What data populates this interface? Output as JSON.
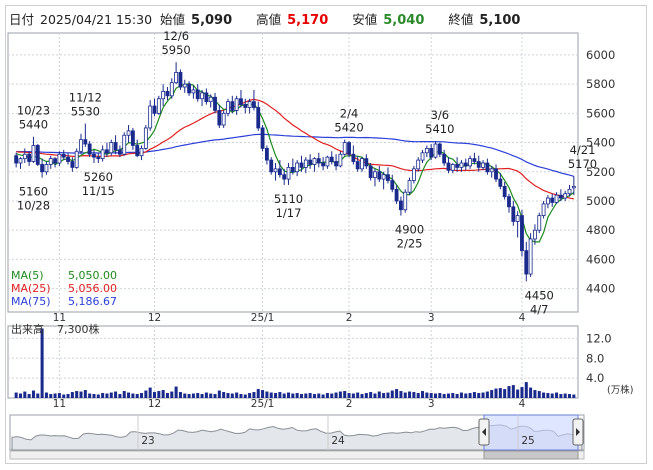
{
  "header": {
    "date_label": "日付",
    "date_value": "2025/04/21 15:30",
    "open_label": "始値",
    "open_value": "5,090",
    "high_label": "高値",
    "high_value": "5,170",
    "low_label": "安値",
    "low_value": "5,040",
    "close_label": "終値",
    "close_value": "5,100"
  },
  "colors": {
    "up_candle": "#ffffff",
    "down_candle": "#1a2a8c",
    "ma5": "#1f8a1f",
    "ma25": "#e02020",
    "ma75": "#2a3fd8",
    "volume": "#1a2a8c",
    "grid": "#cfd4dc"
  },
  "legend": {
    "ma5_label": "MA(5)",
    "ma5_value": "5,050.00",
    "ma25_label": "MA(25)",
    "ma25_value": "5,056.00",
    "ma75_label": "MA(75)",
    "ma75_value": "5,186.67"
  },
  "volume_panel": {
    "title": "出来高",
    "value": "7,300株",
    "unit": "(万株)",
    "ticks": [
      "12.0",
      "8.0",
      "4.0"
    ]
  },
  "navigator": {
    "labels": [
      "23",
      "24",
      "25"
    ]
  },
  "chart_data": {
    "type": "candlestick",
    "ylim": [
      4240,
      6150
    ],
    "yticks": [
      4400,
      4600,
      4800,
      5000,
      5200,
      5400,
      5600,
      5800,
      6000
    ],
    "xticks": [
      {
        "index": 10,
        "label": "11"
      },
      {
        "index": 32,
        "label": "12"
      },
      {
        "index": 57,
        "label": "25/1"
      },
      {
        "index": 77,
        "label": "2"
      },
      {
        "index": 96,
        "label": "3"
      },
      {
        "index": 117,
        "label": "4"
      }
    ],
    "annotations": [
      {
        "index": 4,
        "value": 5440,
        "text": [
          "10/23",
          "5440"
        ],
        "pos": "above"
      },
      {
        "index": 4,
        "value": 5160,
        "text": [
          "5160",
          "10/28"
        ],
        "pos": "below"
      },
      {
        "index": 16,
        "value": 5530,
        "text": [
          "11/12",
          "5530"
        ],
        "pos": "above"
      },
      {
        "index": 19,
        "value": 5260,
        "text": [
          "5260",
          "11/15"
        ],
        "pos": "below"
      },
      {
        "index": 37,
        "value": 5950,
        "text": [
          "12/6",
          "5950"
        ],
        "pos": "above"
      },
      {
        "index": 63,
        "value": 5110,
        "text": [
          "5110",
          "1/17"
        ],
        "pos": "below"
      },
      {
        "index": 77,
        "value": 5420,
        "text": [
          "2/4",
          "5420"
        ],
        "pos": "above"
      },
      {
        "index": 91,
        "value": 4900,
        "text": [
          "4900",
          "2/25"
        ],
        "pos": "below"
      },
      {
        "index": 98,
        "value": 5410,
        "text": [
          "3/6",
          "5410"
        ],
        "pos": "above"
      },
      {
        "index": 121,
        "value": 4450,
        "text": [
          "4450",
          "4/7"
        ],
        "pos": "below"
      },
      {
        "index": 131,
        "value": 5170,
        "text": [
          "4/21",
          "5170"
        ],
        "pos": "above"
      }
    ],
    "ohlc": [
      [
        5310,
        5330,
        5230,
        5260
      ],
      [
        5260,
        5300,
        5220,
        5290
      ],
      [
        5290,
        5360,
        5260,
        5320
      ],
      [
        5320,
        5340,
        5240,
        5270
      ],
      [
        5270,
        5440,
        5260,
        5380
      ],
      [
        5380,
        5390,
        5240,
        5250
      ],
      [
        5250,
        5290,
        5160,
        5200
      ],
      [
        5200,
        5270,
        5180,
        5250
      ],
      [
        5250,
        5310,
        5220,
        5290
      ],
      [
        5290,
        5300,
        5230,
        5260
      ],
      [
        5260,
        5340,
        5240,
        5320
      ],
      [
        5320,
        5350,
        5280,
        5300
      ],
      [
        5300,
        5330,
        5250,
        5270
      ],
      [
        5270,
        5300,
        5200,
        5230
      ],
      [
        5230,
        5360,
        5220,
        5340
      ],
      [
        5340,
        5460,
        5320,
        5420
      ],
      [
        5420,
        5530,
        5370,
        5390
      ],
      [
        5390,
        5410,
        5300,
        5320
      ],
      [
        5320,
        5350,
        5260,
        5300
      ],
      [
        5300,
        5330,
        5260,
        5290
      ],
      [
        5290,
        5380,
        5270,
        5350
      ],
      [
        5350,
        5400,
        5300,
        5330
      ],
      [
        5330,
        5420,
        5310,
        5400
      ],
      [
        5400,
        5450,
        5320,
        5350
      ],
      [
        5350,
        5380,
        5300,
        5320
      ],
      [
        5320,
        5470,
        5310,
        5450
      ],
      [
        5450,
        5520,
        5400,
        5480
      ],
      [
        5480,
        5500,
        5350,
        5380
      ],
      [
        5380,
        5420,
        5300,
        5310
      ],
      [
        5310,
        5380,
        5280,
        5360
      ],
      [
        5360,
        5520,
        5350,
        5500
      ],
      [
        5500,
        5690,
        5480,
        5650
      ],
      [
        5650,
        5700,
        5580,
        5600
      ],
      [
        5600,
        5720,
        5590,
        5700
      ],
      [
        5700,
        5800,
        5650,
        5750
      ],
      [
        5750,
        5780,
        5690,
        5720
      ],
      [
        5720,
        5840,
        5700,
        5810
      ],
      [
        5810,
        5950,
        5800,
        5880
      ],
      [
        5880,
        5900,
        5760,
        5780
      ],
      [
        5780,
        5830,
        5740,
        5800
      ],
      [
        5800,
        5820,
        5720,
        5740
      ],
      [
        5740,
        5790,
        5700,
        5760
      ],
      [
        5760,
        5800,
        5680,
        5700
      ],
      [
        5700,
        5760,
        5650,
        5740
      ],
      [
        5740,
        5770,
        5660,
        5680
      ],
      [
        5680,
        5730,
        5640,
        5710
      ],
      [
        5710,
        5740,
        5600,
        5620
      ],
      [
        5620,
        5660,
        5500,
        5520
      ],
      [
        5520,
        5620,
        5500,
        5600
      ],
      [
        5600,
        5700,
        5580,
        5680
      ],
      [
        5680,
        5720,
        5600,
        5620
      ],
      [
        5620,
        5720,
        5590,
        5700
      ],
      [
        5700,
        5760,
        5640,
        5660
      ],
      [
        5660,
        5700,
        5600,
        5640
      ],
      [
        5640,
        5700,
        5600,
        5680
      ],
      [
        5680,
        5760,
        5620,
        5640
      ],
      [
        5640,
        5680,
        5480,
        5500
      ],
      [
        5500,
        5520,
        5340,
        5360
      ],
      [
        5360,
        5380,
        5250,
        5280
      ],
      [
        5280,
        5300,
        5180,
        5200
      ],
      [
        5200,
        5260,
        5140,
        5220
      ],
      [
        5220,
        5280,
        5160,
        5180
      ],
      [
        5180,
        5220,
        5110,
        5150
      ],
      [
        5150,
        5260,
        5110,
        5230
      ],
      [
        5230,
        5290,
        5180,
        5200
      ],
      [
        5200,
        5280,
        5170,
        5260
      ],
      [
        5260,
        5310,
        5200,
        5230
      ],
      [
        5230,
        5300,
        5190,
        5280
      ],
      [
        5280,
        5320,
        5220,
        5250
      ],
      [
        5250,
        5300,
        5200,
        5290
      ],
      [
        5290,
        5330,
        5230,
        5260
      ],
      [
        5260,
        5300,
        5210,
        5240
      ],
      [
        5240,
        5310,
        5220,
        5300
      ],
      [
        5300,
        5340,
        5250,
        5270
      ],
      [
        5270,
        5320,
        5210,
        5240
      ],
      [
        5240,
        5340,
        5230,
        5320
      ],
      [
        5320,
        5420,
        5310,
        5400
      ],
      [
        5400,
        5410,
        5300,
        5320
      ],
      [
        5320,
        5380,
        5250,
        5270
      ],
      [
        5270,
        5310,
        5200,
        5220
      ],
      [
        5220,
        5300,
        5200,
        5290
      ],
      [
        5290,
        5320,
        5220,
        5240
      ],
      [
        5240,
        5260,
        5140,
        5160
      ],
      [
        5160,
        5220,
        5100,
        5200
      ],
      [
        5200,
        5240,
        5130,
        5150
      ],
      [
        5150,
        5200,
        5080,
        5180
      ],
      [
        5180,
        5230,
        5120,
        5140
      ],
      [
        5140,
        5180,
        5060,
        5080
      ],
      [
        5080,
        5110,
        4980,
        5000
      ],
      [
        5000,
        5030,
        4900,
        4940
      ],
      [
        4940,
        5080,
        4920,
        5060
      ],
      [
        5060,
        5160,
        5040,
        5140
      ],
      [
        5140,
        5240,
        5120,
        5220
      ],
      [
        5220,
        5300,
        5200,
        5280
      ],
      [
        5280,
        5350,
        5260,
        5330
      ],
      [
        5330,
        5380,
        5300,
        5360
      ],
      [
        5360,
        5390,
        5280,
        5300
      ],
      [
        5300,
        5410,
        5290,
        5390
      ],
      [
        5390,
        5400,
        5300,
        5320
      ],
      [
        5320,
        5350,
        5240,
        5260
      ],
      [
        5260,
        5300,
        5190,
        5210
      ],
      [
        5210,
        5260,
        5190,
        5250
      ],
      [
        5250,
        5300,
        5200,
        5230
      ],
      [
        5230,
        5280,
        5200,
        5260
      ],
      [
        5260,
        5290,
        5210,
        5240
      ],
      [
        5240,
        5310,
        5220,
        5290
      ],
      [
        5290,
        5330,
        5250,
        5270
      ],
      [
        5270,
        5310,
        5200,
        5230
      ],
      [
        5230,
        5280,
        5210,
        5260
      ],
      [
        5260,
        5290,
        5180,
        5200
      ],
      [
        5200,
        5240,
        5160,
        5220
      ],
      [
        5220,
        5250,
        5130,
        5150
      ],
      [
        5150,
        5190,
        5080,
        5100
      ],
      [
        5100,
        5130,
        5010,
        5030
      ],
      [
        5030,
        5050,
        4920,
        4960
      ],
      [
        4960,
        5000,
        4830,
        4860
      ],
      [
        4860,
        4930,
        4750,
        4900
      ],
      [
        4900,
        4940,
        4620,
        4660
      ],
      [
        4660,
        4720,
        4450,
        4500
      ],
      [
        4500,
        4780,
        4480,
        4740
      ],
      [
        4740,
        4840,
        4700,
        4800
      ],
      [
        4800,
        4920,
        4780,
        4900
      ],
      [
        4900,
        5000,
        4880,
        4980
      ],
      [
        4980,
        5040,
        4950,
        5020
      ],
      [
        5020,
        5050,
        4960,
        4990
      ],
      [
        4990,
        5060,
        4980,
        5040
      ],
      [
        5040,
        5080,
        5000,
        5020
      ],
      [
        5020,
        5070,
        5000,
        5050
      ],
      [
        5050,
        5110,
        5030,
        5080
      ],
      [
        5090,
        5170,
        5040,
        5100
      ]
    ],
    "volume": [
      1.1,
      0.9,
      1.3,
      0.8,
      1.5,
      0.9,
      14.0,
      1.1,
      0.8,
      0.9,
      1.0,
      0.7,
      0.8,
      1.2,
      1.4,
      1.3,
      1.6,
      0.9,
      0.8,
      0.7,
      1.0,
      0.9,
      1.1,
      1.3,
      0.8,
      1.4,
      1.1,
      0.9,
      0.8,
      1.0,
      1.5,
      2.1,
      1.2,
      1.4,
      1.6,
      1.0,
      1.3,
      2.3,
      1.2,
      0.9,
      0.8,
      0.9,
      1.0,
      0.8,
      1.1,
      0.9,
      0.8,
      1.5,
      1.2,
      1.0,
      0.9,
      1.1,
      0.8,
      0.7,
      1.0,
      1.2,
      1.8,
      1.6,
      1.3,
      1.1,
      1.0,
      1.2,
      0.9,
      1.1,
      0.9,
      1.0,
      0.8,
      0.9,
      1.0,
      0.8,
      0.9,
      0.7,
      1.0,
      0.9,
      1.1,
      1.3,
      1.4,
      1.0,
      0.9,
      1.1,
      0.8,
      1.0,
      1.2,
      0.9,
      1.3,
      1.0,
      1.1,
      1.5,
      1.8,
      1.4,
      1.1,
      1.3,
      1.2,
      1.0,
      1.4,
      1.1,
      1.0,
      0.9,
      1.0,
      0.8,
      0.9,
      1.0,
      0.8,
      1.1,
      0.9,
      1.0,
      1.2,
      1.0,
      1.1,
      1.3,
      1.6,
      1.9,
      2.0,
      1.8,
      2.4,
      2.6,
      1.7,
      2.2,
      3.2,
      2.1,
      1.6,
      1.4,
      1.1,
      1.0,
      0.9,
      1.1,
      0.8,
      0.9,
      0.8,
      0.7
    ]
  }
}
